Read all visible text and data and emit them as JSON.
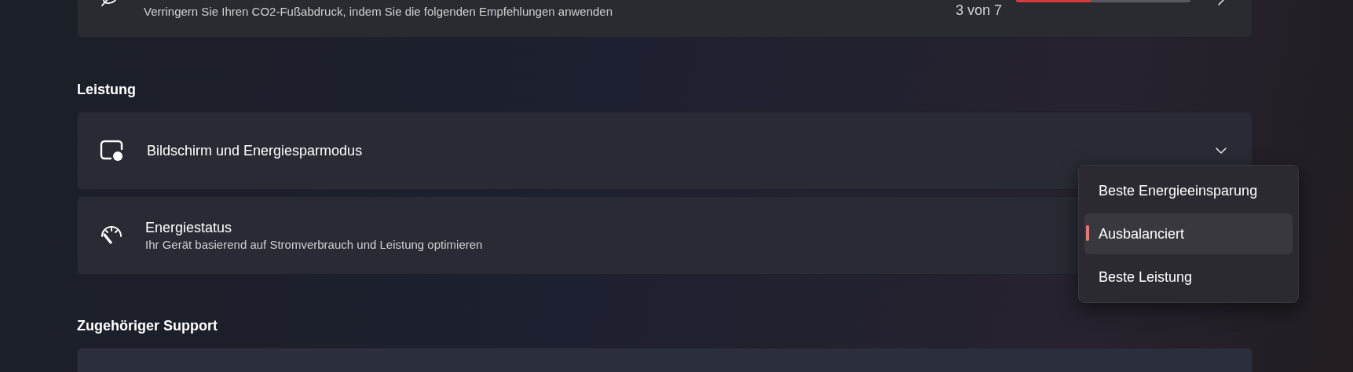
{
  "eco_card": {
    "description": "Verringern Sie Ihren CO2-Fußabdruck, indem Sie die folgenden Empfehlungen anwenden",
    "count": "3 von 7",
    "level": 0.43
  },
  "sections": [
    {
      "heading": "Leistung",
      "items": [
        {
          "kind": "display",
          "title": "Bildschirm und Energiesparmodus",
          "expanded": false
        },
        {
          "kind": "power",
          "title": "Energiestatus",
          "description": "Ihr Gerät basierend auf Stromverbrauch und Leistung optimieren"
        }
      ]
    },
    {
      "heading": "Zugehöriger Support",
      "items": [
        {
          "kind": "empty"
        }
      ]
    }
  ],
  "power_menu": [
    {
      "label": "Beste Energieeinsparung",
      "selected": false
    },
    {
      "label": "Ausbalanciert",
      "selected": true
    },
    {
      "label": "Beste Leistung",
      "selected": false
    }
  ]
}
